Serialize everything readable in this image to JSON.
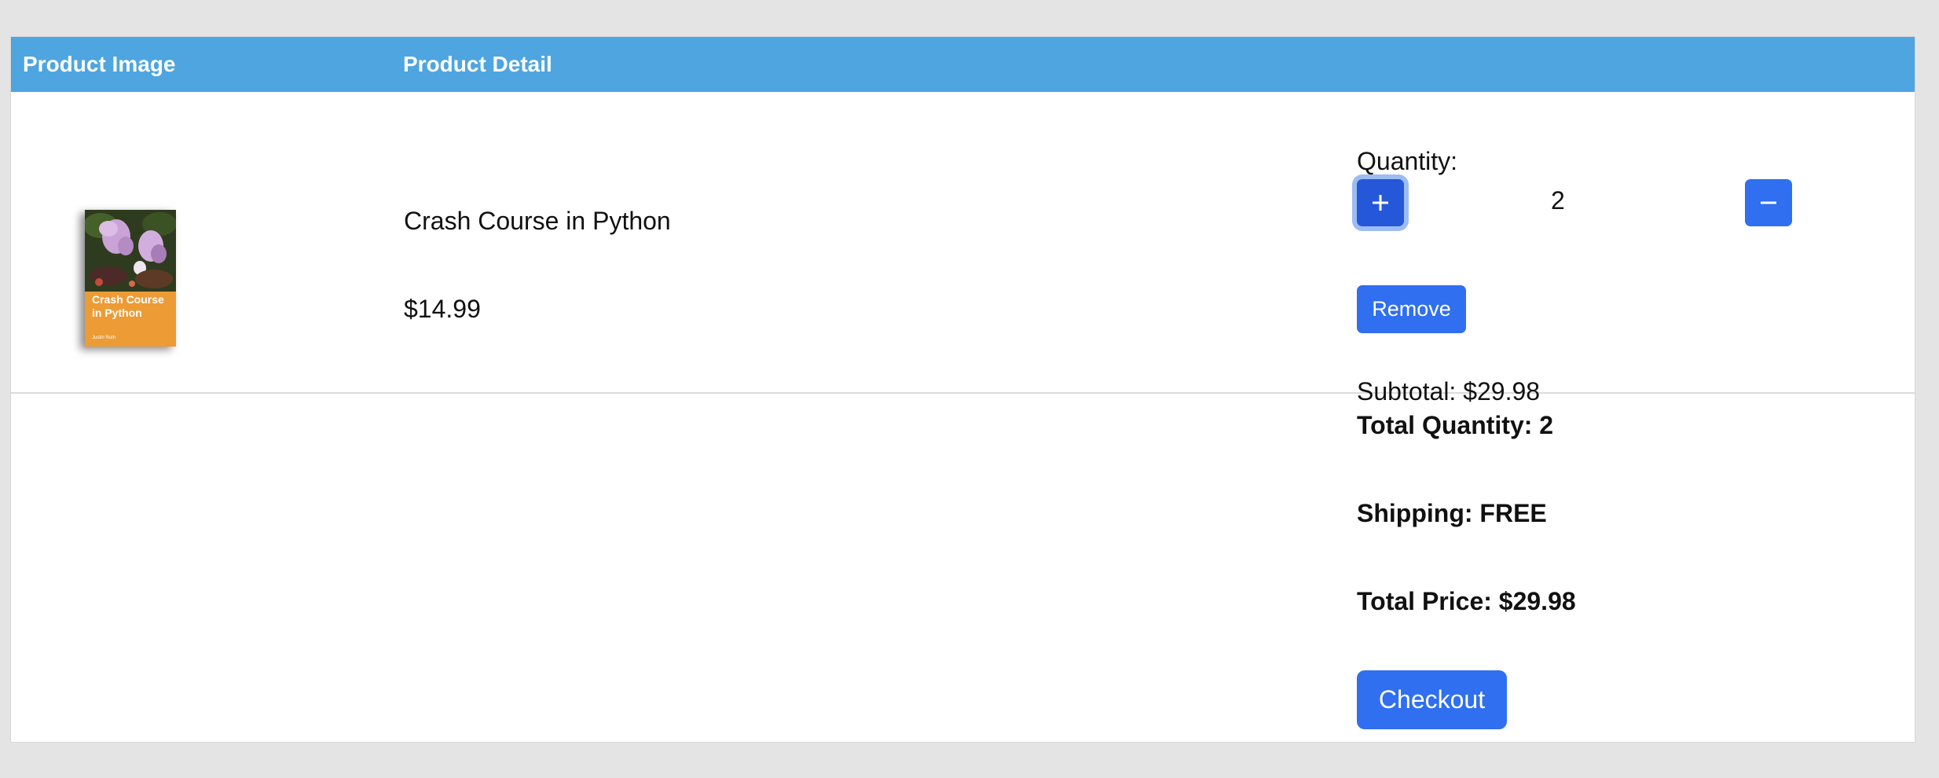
{
  "table": {
    "header": {
      "product_image": "Product Image",
      "product_detail": "Product Detail"
    }
  },
  "item": {
    "cover": {
      "title": "Crash Course in Python",
      "author": "Justin Ruth"
    },
    "name": "Crash Course in Python",
    "price": "$14.99",
    "quantity_label": "Quantity:",
    "quantity": "2",
    "plus_icon": "plus-icon",
    "minus_icon": "minus-icon",
    "remove_label": "Remove",
    "subtotal": "Subtotal: $29.98"
  },
  "summary": {
    "total_quantity": "Total Quantity: 2",
    "shipping": "Shipping: FREE",
    "total_price": "Total Price: $29.98",
    "checkout_label": "Checkout"
  },
  "colors": {
    "header_bg": "#4ea5e0",
    "button": "#2f6ff0",
    "button_focused": "#2558d8",
    "page_bg": "#e4e4e4",
    "cover_orange": "#ec9b35"
  }
}
